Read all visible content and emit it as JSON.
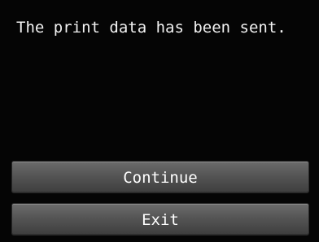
{
  "screen": {
    "message": "The print data has been sent."
  },
  "buttons": {
    "continue_label": "Continue",
    "exit_label": "Exit"
  },
  "colors": {
    "background": "#050505",
    "text": "#f2f2f2",
    "button": "#555555"
  }
}
